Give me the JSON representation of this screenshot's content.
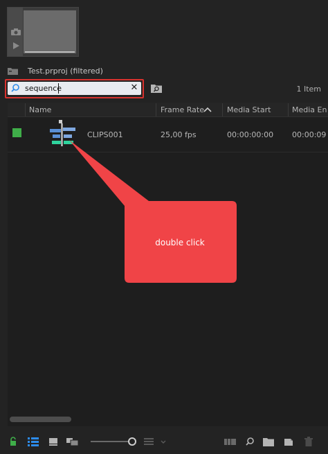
{
  "project": {
    "name": "Test.prproj (filtered)"
  },
  "search": {
    "value": "sequence"
  },
  "item_count": "1 Item",
  "columns": [
    "Name",
    "Frame Rate",
    "Media Start",
    "Media En"
  ],
  "rows": [
    {
      "name": "CLIPS001",
      "frame_rate": "25,00 fps",
      "media_start": "00:00:00:00",
      "media_end": "00:00:09"
    }
  ],
  "annotation": {
    "text": "double click"
  },
  "colors": {
    "accent_red": "#d8322e",
    "callout": "#f04447",
    "label_green": "#3fae49",
    "blue_icon": "#2d8ceb"
  },
  "icons": [
    "camera-icon",
    "play-icon",
    "bin-icon",
    "search-icon",
    "clear-icon",
    "find-bin-icon",
    "sort-ascending-icon",
    "sequence-icon",
    "lock-icon",
    "list-view-icon",
    "icon-view-icon",
    "freeform-view-icon",
    "sort-icon",
    "automate-icon",
    "find-icon",
    "new-bin-icon",
    "new-item-icon",
    "trash-icon"
  ]
}
